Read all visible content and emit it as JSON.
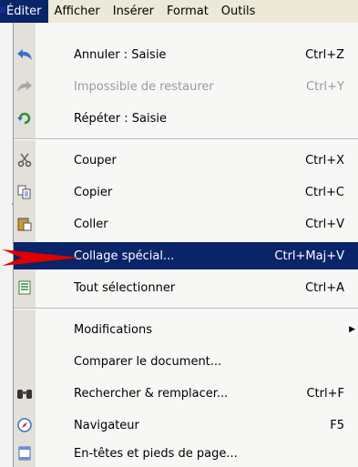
{
  "menubar": {
    "items": [
      {
        "label": "Éditer",
        "active": true
      },
      {
        "label": "Afficher"
      },
      {
        "label": "Insérer"
      },
      {
        "label": "Format"
      },
      {
        "label": "Outils"
      }
    ]
  },
  "menu": {
    "items": [
      {
        "icon": "undo-icon",
        "label": "Annuler : Saisie",
        "shortcut": "Ctrl+Z"
      },
      {
        "icon": "redo-icon",
        "label": "Impossible de restaurer",
        "shortcut": "Ctrl+Y",
        "disabled": true
      },
      {
        "icon": "repeat-icon",
        "label": "Répéter : Saisie",
        "shortcut": ""
      },
      {
        "icon": "scissors-icon",
        "label": "Couper",
        "shortcut": "Ctrl+X"
      },
      {
        "icon": "copy-icon",
        "label": "Copier",
        "shortcut": "Ctrl+C"
      },
      {
        "icon": "paste-icon",
        "label": "Coller",
        "shortcut": "Ctrl+V"
      },
      {
        "icon": "",
        "label": "Collage spécial...",
        "shortcut": "Ctrl+Maj+V",
        "highlighted": true
      },
      {
        "icon": "select-all-icon",
        "label": "Tout sélectionner",
        "shortcut": "Ctrl+A"
      },
      {
        "icon": "",
        "label": "Modifications",
        "shortcut": "",
        "submenu": true
      },
      {
        "icon": "",
        "label": "Comparer le document...",
        "shortcut": ""
      },
      {
        "icon": "binoculars-icon",
        "label": "Rechercher & remplacer...",
        "shortcut": "Ctrl+F"
      },
      {
        "icon": "compass-icon",
        "label": "Navigateur",
        "shortcut": "F5"
      },
      {
        "icon": "header-footer-icon",
        "label": "En-têtes et pieds de page...",
        "shortcut": ""
      }
    ]
  },
  "colors": {
    "highlight": "#0a246a",
    "background": "#5ab0ee",
    "pointer": "#e00000"
  }
}
